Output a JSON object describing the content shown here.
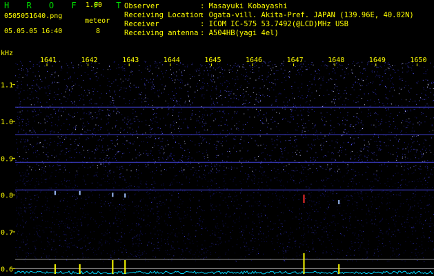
{
  "app": {
    "title": "H R O F F T",
    "version": "1.00"
  },
  "file": {
    "name": "0505051640.png",
    "datetime": "05.05.05 16:40"
  },
  "meteor": {
    "label": "meteor",
    "count": "8"
  },
  "header": [
    {
      "label": "Observer",
      "value": ": Masayuki Kobayashi"
    },
    {
      "label": "Receiving Location",
      "value": ": Ogata-vill. Akita-Pref. JAPAN (139.96E, 40.02N)"
    },
    {
      "label": "Receiver",
      "value": ": ICOM IC-575 53.7492(@LCD)MHz USB"
    },
    {
      "label": "Receiving antenna",
      "value": ": A504HB(yagi 4el)"
    }
  ],
  "colors": {
    "background": "#000000",
    "text": "#ffff00",
    "title": "#00e000",
    "noise": "#3a3aff",
    "echo": "#ff3030",
    "trace": "#00e0ff"
  },
  "chart_data": {
    "type": "heatmap",
    "ylabel": "kHz",
    "x_ticks": [
      "1641",
      "1642",
      "1643",
      "1644",
      "1645",
      "1646",
      "1647",
      "1648",
      "1649",
      "1650"
    ],
    "y_ticks": [
      "1.1",
      "1.0",
      "0.9",
      "0.8",
      "0.7",
      "0.6"
    ],
    "ylim": [
      0.58,
      1.18
    ],
    "horizontal_lines_khz": [
      1.04,
      0.965,
      0.89,
      0.815
    ],
    "echoes": [
      {
        "minute": 1641.2,
        "khz": 0.8
      },
      {
        "minute": 1641.8,
        "khz": 0.8
      },
      {
        "minute": 1642.6,
        "khz": 0.795
      },
      {
        "minute": 1642.9,
        "khz": 0.793
      },
      {
        "minute": 1647.25,
        "khz": 0.79
      },
      {
        "minute": 1648.1,
        "khz": 0.775
      }
    ]
  }
}
